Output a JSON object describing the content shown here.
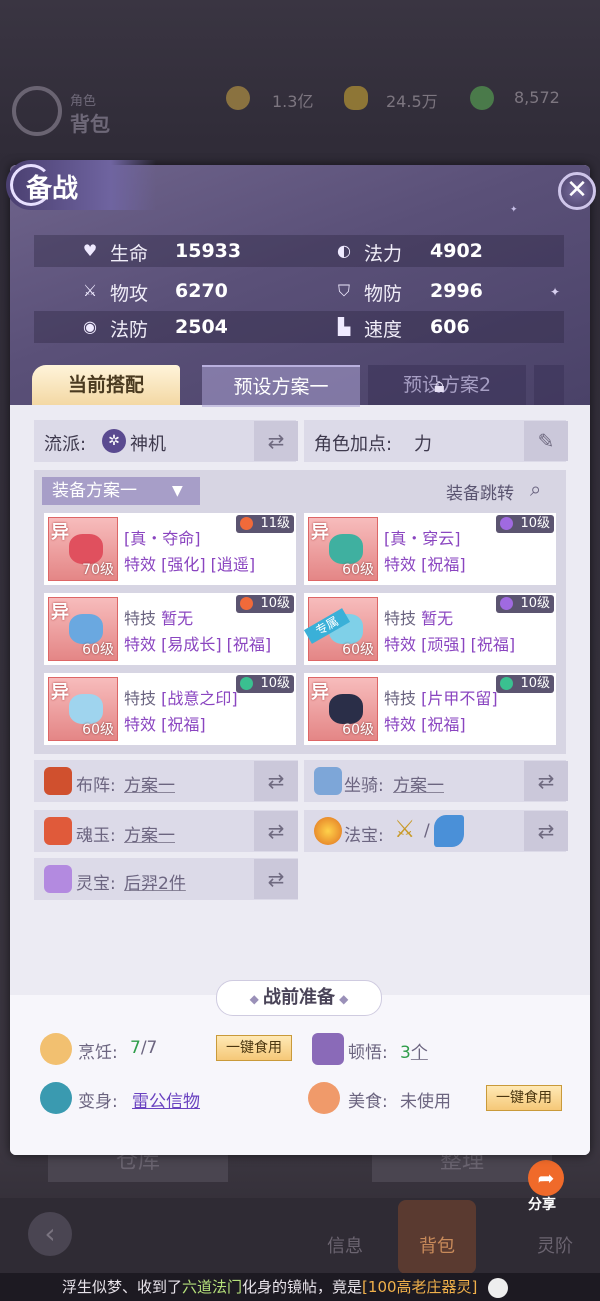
{
  "background": {
    "role_label": "角色",
    "bag_label": "背包",
    "currencies": [
      {
        "icon": "copper-coin-icon",
        "value": "1.3亿"
      },
      {
        "icon": "gold-ingot-icon",
        "value": "24.5万"
      },
      {
        "icon": "jade-icon",
        "value": "8,572"
      }
    ],
    "bottom_buttons": [
      "仓库",
      "整理"
    ],
    "nav": [
      "信息",
      "背包",
      "灵阶"
    ],
    "share_label": "分享",
    "marquee": {
      "part1": "浮生似梦、收到了",
      "part2": "六道法门",
      "part3": "化身的镜帖，竟是",
      "part4": "[100高老庄器灵]"
    }
  },
  "panel": {
    "title": "备战",
    "close_icon": "close-icon",
    "stats": [
      {
        "icon": "heart-icon",
        "label": "生命",
        "value": "15933"
      },
      {
        "icon": "swirl-icon",
        "label": "法力",
        "value": "4902"
      },
      {
        "icon": "sword-icon",
        "label": "物攻",
        "value": "6270"
      },
      {
        "icon": "shield-icon",
        "label": "物防",
        "value": "2996"
      },
      {
        "icon": "magic-shield-icon",
        "label": "法防",
        "value": "2504"
      },
      {
        "icon": "boot-icon",
        "label": "速度",
        "value": "606"
      }
    ],
    "tabs": {
      "current": "当前搭配",
      "preset1": "预设方案一",
      "preset2": "预设方案2"
    },
    "school": {
      "label": "流派:",
      "value": "神机"
    },
    "attr_point": {
      "label": "角色加点:",
      "value": "力"
    },
    "equip": {
      "dropdown": "装备方案一",
      "jump": "装备跳转",
      "items": [
        {
          "tag": "异",
          "level": "70级",
          "badge": "11级",
          "line1_label": "",
          "line1": "[真・夺命]",
          "line2_label": "特效",
          "line2": "[强化] [逍遥]",
          "pic": "#e0505e",
          "badge_color": "#f06a3a"
        },
        {
          "tag": "异",
          "level": "60级",
          "badge": "10级",
          "line1_label": "",
          "line1": "[真・穿云]",
          "line2_label": "特效",
          "line2": "[祝福]",
          "pic": "#3fb0a0",
          "badge_color": "#a06ae0"
        },
        {
          "tag": "异",
          "level": "60级",
          "badge": "10级",
          "line1_label": "特技",
          "line1": "暂无",
          "line2_label": "特效",
          "line2": "[易成长] [祝福]",
          "pic": "#6aa8e0",
          "badge_color": "#f06a3a"
        },
        {
          "tag": "专属",
          "level": "60级",
          "badge": "10级",
          "line1_label": "特技",
          "line1": "暂无",
          "line2_label": "特效",
          "line2": "[顽强] [祝福]",
          "pic": "#7fd0e8",
          "badge_color": "#a06ae0"
        },
        {
          "tag": "异",
          "level": "60级",
          "badge": "10级",
          "line1_label": "特技",
          "line1": "[战意之印]",
          "line2_label": "特效",
          "line2": "[祝福]",
          "pic": "#9fd4ee",
          "badge_color": "#3ac090"
        },
        {
          "tag": "异",
          "level": "60级",
          "badge": "10级",
          "line1_label": "特技",
          "line1": "[片甲不留]",
          "line2_label": "特效",
          "line2": "[祝福]",
          "pic": "#2a2e48",
          "badge_color": "#3ac090"
        }
      ]
    },
    "formation": {
      "label": "布阵:",
      "value": "方案一"
    },
    "mount": {
      "label": "坐骑:",
      "value": "方案一"
    },
    "soul_jade": {
      "label": "魂玉:",
      "value": "方案一"
    },
    "treasure": {
      "label": "法宝:",
      "separator": "/"
    },
    "spirit_treasure": {
      "label": "灵宝:",
      "value": "后羿2件"
    },
    "prep": {
      "title": "战前准备",
      "cooking": {
        "label": "烹饪:",
        "value": "7",
        "total": "/7"
      },
      "eat_btn": "一键食用",
      "insight": {
        "label": "顿悟:",
        "value": "3",
        "unit": "个"
      },
      "transform": {
        "label": "变身:",
        "value": "雷公信物"
      },
      "food": {
        "label": "美食:",
        "value": "未使用"
      },
      "eat_btn2": "一键食用"
    }
  }
}
